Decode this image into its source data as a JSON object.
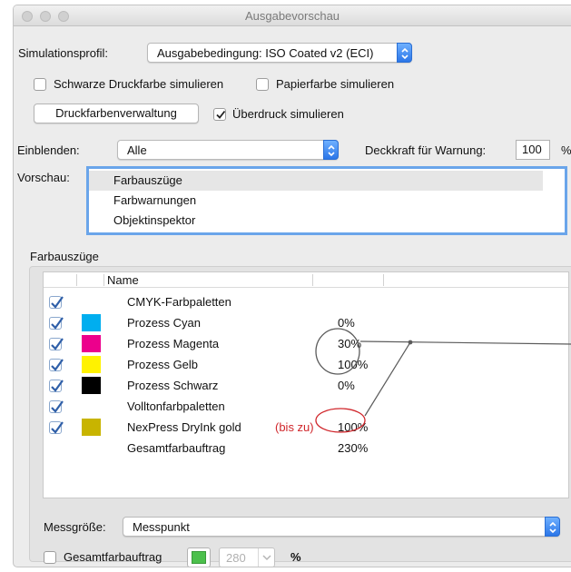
{
  "window": {
    "title": "Ausgabevorschau"
  },
  "simulation": {
    "label": "Simulationsprofil:",
    "value": "Ausgabebedingung: ISO Coated v2 (ECI)",
    "black_ink_label": "Schwarze Druckfarbe simulieren",
    "paper_color_label": "Papierfarbe simulieren",
    "ink_manager_label": "Druckfarbenverwaltung",
    "overprint_label": "Überdruck simulieren",
    "overprint_checked": true
  },
  "show": {
    "label": "Einblenden:",
    "value": "Alle",
    "opacity_label": "Deckkraft für Warnung:",
    "opacity_value": "100",
    "opacity_unit": "%"
  },
  "preview": {
    "label": "Vorschau:",
    "items": [
      "Farbauszüge",
      "Farbwarnungen",
      "Objektinspektor"
    ],
    "selected": "Farbauszüge"
  },
  "separations": {
    "group_label": "Farbauszüge",
    "column_name": "Name",
    "rows": [
      {
        "name": "CMYK-Farbpaletten",
        "value": "",
        "note": "",
        "swatch": "",
        "checked": true
      },
      {
        "name": "Prozess Cyan",
        "value": "0%",
        "note": "",
        "swatch": "#00aeef",
        "checked": true
      },
      {
        "name": "Prozess Magenta",
        "value": "30%",
        "note": "",
        "swatch": "#ec008c",
        "checked": true
      },
      {
        "name": "Prozess Gelb",
        "value": "100%",
        "note": "",
        "swatch": "#fff200",
        "checked": true
      },
      {
        "name": "Prozess Schwarz",
        "value": "0%",
        "note": "",
        "swatch": "#000000",
        "checked": true
      },
      {
        "name": "Volltonfarbpaletten",
        "value": "",
        "note": "",
        "swatch": "",
        "checked": true
      },
      {
        "name": "NexPress DryInk gold",
        "value": "100%",
        "note": "(bis zu)",
        "swatch": "#c8b400",
        "checked": true
      },
      {
        "name": "Gesamtfarbauftrag",
        "value": "230%",
        "note": "",
        "swatch": "",
        "checked": false
      }
    ]
  },
  "measure": {
    "label": "Messgröße:",
    "value": "Messpunkt",
    "total_ink_label": "Gesamtfarbauftrag",
    "total_ink_value": "280",
    "total_ink_unit": "%",
    "total_ink_color": "#4cc04c"
  },
  "colors": {
    "accent": "#3b82f0",
    "selection_border": "#6aa5ea",
    "annotation_dark": "#5b5b5b",
    "annotation_red": "#d0262b"
  }
}
